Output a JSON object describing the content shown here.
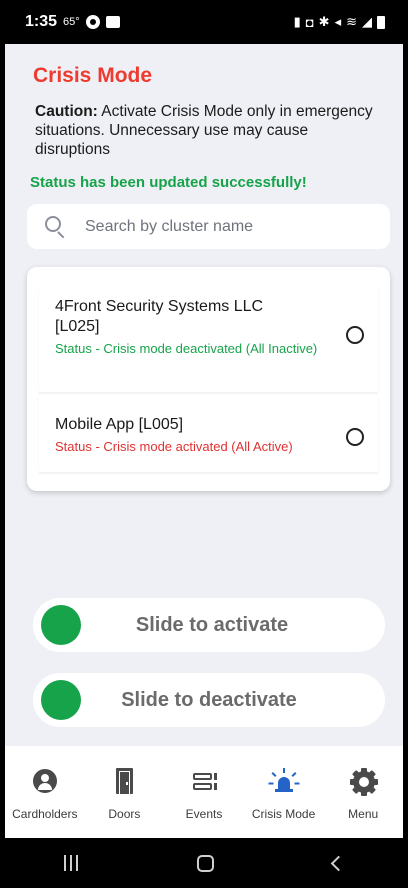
{
  "status_bar": {
    "time": "1:35",
    "temp": "65°",
    "icons": [
      "dot-icon",
      "gallery-icon",
      "battery-saver-icon",
      "nfc-icon",
      "bluetooth-icon",
      "mute-icon",
      "wifi-icon",
      "signal-icon",
      "battery-icon"
    ]
  },
  "header": {
    "title": "Crisis Mode",
    "caution_label": "Caution:",
    "caution_text": " Activate Crisis Mode only in emergency situations. Unnecessary use may cause disruptions",
    "success_message": "Status has been updated successfully!"
  },
  "search": {
    "placeholder": "Search by cluster name",
    "value": ""
  },
  "clusters": [
    {
      "name": "4Front Security Systems LLC [L025]",
      "status": "Status - Crisis mode deactivated (All Inactive)",
      "selected": false
    },
    {
      "name": "Mobile App [L005]",
      "status": "Status - Crisis mode activated (All Active)",
      "selected": false
    }
  ],
  "sliders": {
    "activate_label": "Slide to activate",
    "deactivate_label": "Slide to deactivate"
  },
  "bottom_nav": [
    {
      "label": "Cardholders",
      "icon": "person-circle-icon",
      "active": false
    },
    {
      "label": "Doors",
      "icon": "door-icon",
      "active": false
    },
    {
      "label": "Events",
      "icon": "events-icon",
      "active": false
    },
    {
      "label": "Crisis Mode",
      "icon": "siren-icon",
      "active": true
    },
    {
      "label": "Menu",
      "icon": "gear-icon",
      "active": false
    }
  ],
  "colors": {
    "title": "#ee3b2f",
    "success": "#17a34a",
    "danger": "#e03131",
    "accent": "#2563c9",
    "knob": "#16a34a"
  }
}
